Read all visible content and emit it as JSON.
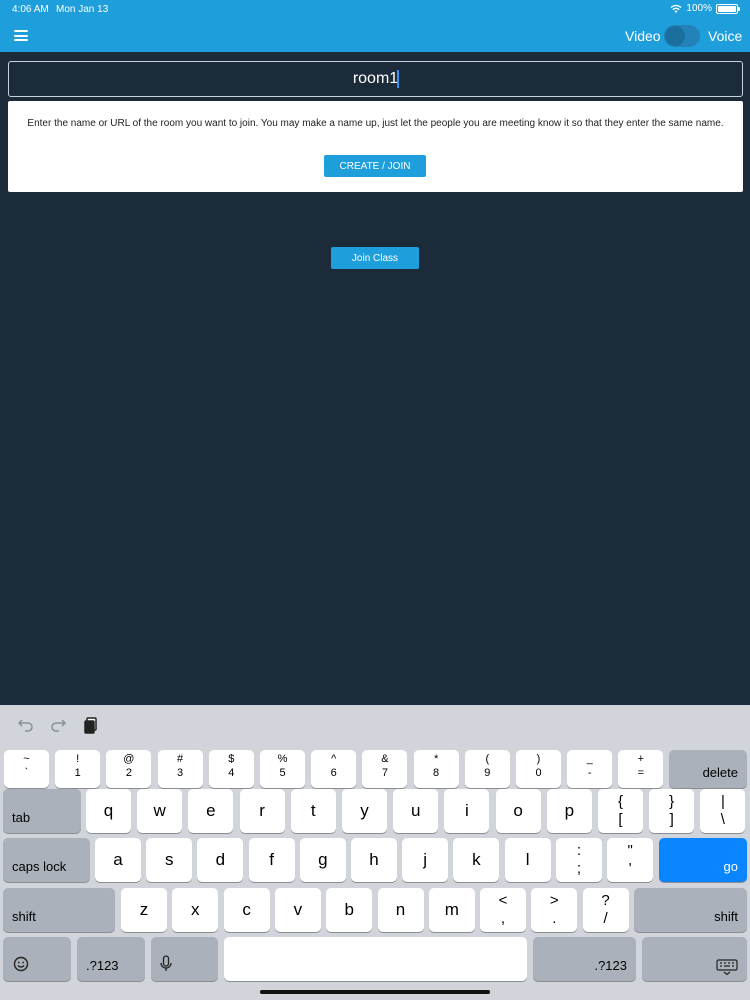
{
  "status": {
    "time": "4:06 AM",
    "date": "Mon Jan 13",
    "battery": "100%",
    "battery_level": 1.0
  },
  "header": {
    "video_label": "Video",
    "voice_label": "Voice",
    "menu_icon": "hamburger-menu-icon"
  },
  "room": {
    "value": "room1"
  },
  "card": {
    "text": "Enter the name or URL of the room you want to join. You may make a name up, just let the people you are meeting know it so that they enter the same name.",
    "create_label": "CREATE / JOIN"
  },
  "join_class_label": "Join Class",
  "keyboard": {
    "row1": [
      {
        "top": "~",
        "bot": "`"
      },
      {
        "top": "!",
        "bot": "1"
      },
      {
        "top": "@",
        "bot": "2"
      },
      {
        "top": "#",
        "bot": "3"
      },
      {
        "top": "$",
        "bot": "4"
      },
      {
        "top": "%",
        "bot": "5"
      },
      {
        "top": "^",
        "bot": "6"
      },
      {
        "top": "&",
        "bot": "7"
      },
      {
        "top": "*",
        "bot": "8"
      },
      {
        "top": "(",
        "bot": "9"
      },
      {
        "top": ")",
        "bot": "0"
      },
      {
        "top": "_",
        "bot": "-"
      },
      {
        "top": "+",
        "bot": "="
      }
    ],
    "delete_label": "delete",
    "tab_label": "tab",
    "row2": [
      "q",
      "w",
      "e",
      "r",
      "t",
      "y",
      "u",
      "i",
      "o",
      "p"
    ],
    "row2_syms": [
      {
        "top": "{",
        "bot": "["
      },
      {
        "top": "}",
        "bot": "]"
      },
      {
        "top": "|",
        "bot": "\\"
      }
    ],
    "caps_label": "caps lock",
    "row3": [
      "a",
      "s",
      "d",
      "f",
      "g",
      "h",
      "j",
      "k",
      "l"
    ],
    "row3_syms": [
      {
        "top": ":",
        "bot": ";"
      },
      {
        "top": "\"",
        "bot": "'"
      }
    ],
    "go_label": "go",
    "shift_label": "shift",
    "row4": [
      "z",
      "x",
      "c",
      "v",
      "b",
      "n",
      "m"
    ],
    "row4_syms": [
      {
        "top": "<",
        "bot": ","
      },
      {
        "top": ">",
        "bot": "."
      },
      {
        "top": "?",
        "bot": "/"
      }
    ],
    "num_label": ".?123",
    "emoji_icon": "emoji-icon",
    "mic_icon": "microphone-icon",
    "hide_icon": "keyboard-hide-icon",
    "undo_icon": "undo-icon",
    "redo_icon": "redo-icon",
    "paste_icon": "paste-icon"
  },
  "colors": {
    "accent": "#1e9fdb",
    "background": "#1b2b3a",
    "go_key": "#0a84ff"
  }
}
